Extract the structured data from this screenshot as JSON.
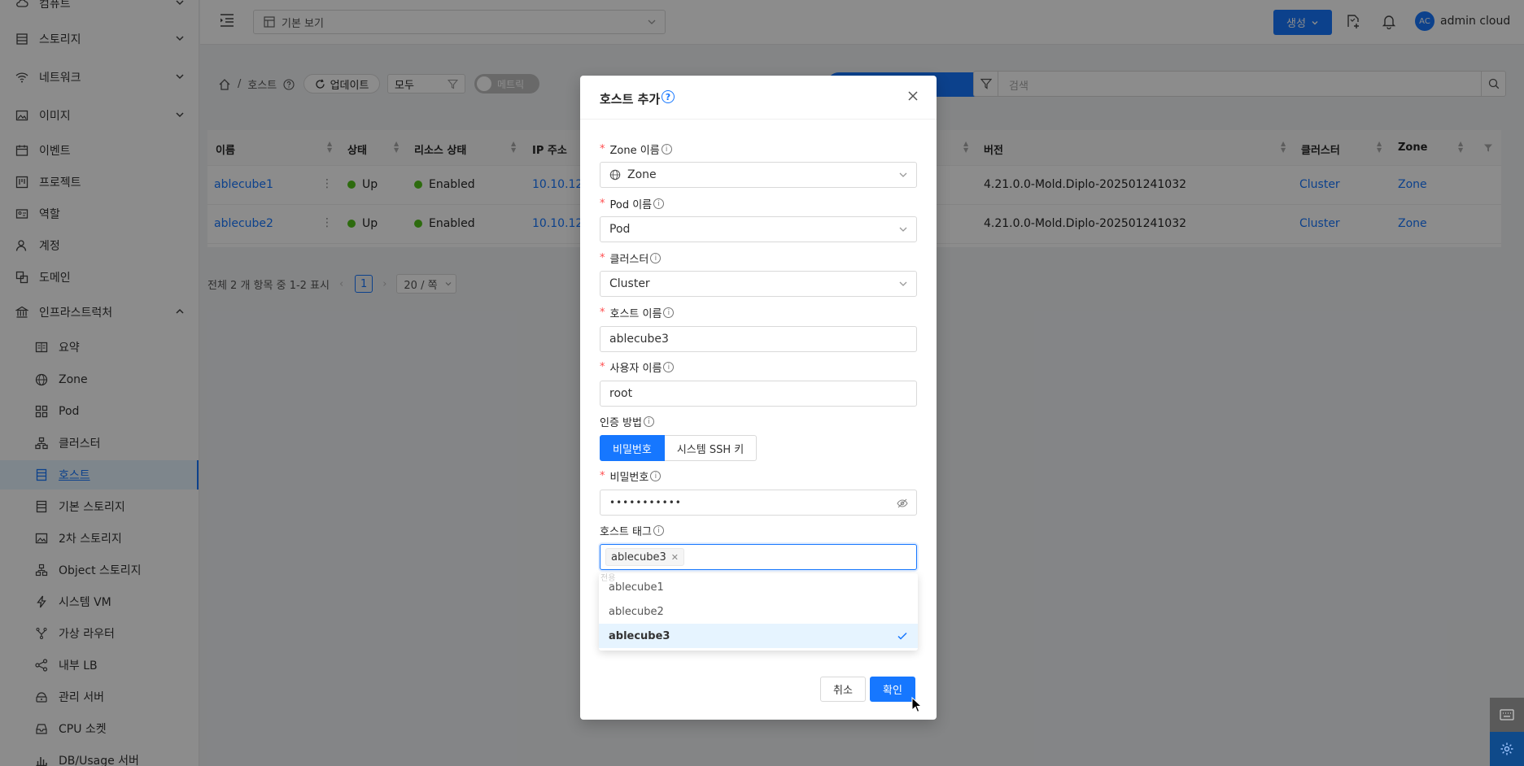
{
  "sidebar": {
    "items": [
      {
        "label": "컴퓨트",
        "icon": "cloud-icon",
        "chevron": "down"
      },
      {
        "label": "스토리지",
        "icon": "storage-icon",
        "chevron": "down"
      },
      {
        "label": "네트워크",
        "icon": "wifi-icon",
        "chevron": "down"
      },
      {
        "label": "이미지",
        "icon": "image-icon",
        "chevron": "down"
      },
      {
        "label": "이벤트",
        "icon": "calendar-icon"
      },
      {
        "label": "프로젝트",
        "icon": "project-icon"
      },
      {
        "label": "역할",
        "icon": "id-card-icon"
      },
      {
        "label": "계정",
        "icon": "user-icon"
      },
      {
        "label": "도메인",
        "icon": "domain-icon"
      },
      {
        "label": "인프라스트럭처",
        "icon": "bank-icon",
        "chevron": "up"
      }
    ],
    "sub_items": [
      {
        "label": "요약",
        "icon": "summary-icon"
      },
      {
        "label": "Zone",
        "icon": "globe-icon"
      },
      {
        "label": "Pod",
        "icon": "grid-icon"
      },
      {
        "label": "클러스터",
        "icon": "cluster-icon"
      },
      {
        "label": "호스트",
        "icon": "host-icon",
        "active": true
      },
      {
        "label": "기본 스토리지",
        "icon": "primary-storage-icon"
      },
      {
        "label": "2차 스토리지",
        "icon": "secondary-storage-icon"
      },
      {
        "label": "Object 스토리지",
        "icon": "object-storage-icon"
      },
      {
        "label": "시스템 VM",
        "icon": "thunder-icon"
      },
      {
        "label": "가상 라우터",
        "icon": "router-icon"
      },
      {
        "label": "내부 LB",
        "icon": "share-icon"
      },
      {
        "label": "관리 서버",
        "icon": "server-icon"
      },
      {
        "label": "CPU 소켓",
        "icon": "inbox-icon"
      },
      {
        "label": "DB/Usage 서버",
        "icon": "bar-chart-icon"
      }
    ]
  },
  "header": {
    "view_select": "기본 보기",
    "create_label": "생성",
    "avatar_initials": "AC",
    "username": "admin cloud"
  },
  "toolbar": {
    "breadcrumb_sep": "/",
    "breadcrumb_current": "호스트",
    "update_label": "업데이트",
    "filter_value": "모두",
    "metric_label": "메트릭",
    "search_placeholder": "검색"
  },
  "table": {
    "columns": [
      "이름",
      "상태",
      "리소스 상태",
      "IP 주소",
      "버전",
      "클러스터",
      "Zone"
    ],
    "rows": [
      {
        "name": "ablecube1",
        "status": "Up",
        "resource_state": "Enabled",
        "ip": "10.10.12",
        "version": "4.21.0.0-Mold.Diplo-202501241032",
        "cluster": "Cluster",
        "zone": "Zone"
      },
      {
        "name": "ablecube2",
        "status": "Up",
        "resource_state": "Enabled",
        "ip": "10.10.12",
        "version": "4.21.0.0-Mold.Diplo-202501241032",
        "cluster": "Cluster",
        "zone": "Zone"
      }
    ]
  },
  "pagination": {
    "summary": "전체 2 개 항목 중 1-2 표시",
    "current_page": "1",
    "page_size": "20 / 쪽"
  },
  "modal": {
    "title": "호스트 추가",
    "fields": {
      "zone_label": "Zone 이름",
      "zone_value": "Zone",
      "pod_label": "Pod 이름",
      "pod_value": "Pod",
      "cluster_label": "클러스터",
      "cluster_value": "Cluster",
      "hostname_label": "호스트 이름",
      "hostname_value": "ablecube3",
      "username_label": "사용자 이름",
      "username_value": "root",
      "auth_label": "인증 방법",
      "auth_options": [
        "비밀번호",
        "시스템 SSH 키"
      ],
      "password_label": "비밀번호",
      "password_value": "•••••••••••",
      "hosttag_label": "호스트 태그",
      "hosttag_selected": "ablecube3"
    },
    "dropdown": {
      "ghost_text": "전용",
      "options": [
        "ablecube1",
        "ablecube2",
        "ablecube3"
      ],
      "selected": "ablecube3"
    },
    "cancel_label": "취소",
    "ok_label": "확인"
  },
  "colors": {
    "primary": "#1677ff",
    "status_up": "#52c41a"
  }
}
